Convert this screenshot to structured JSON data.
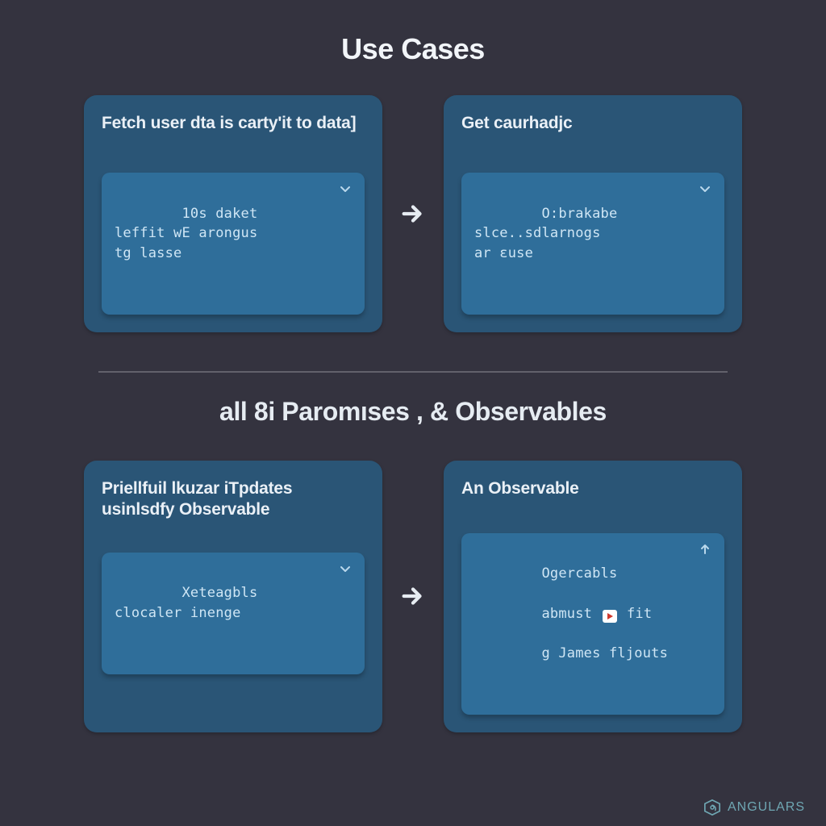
{
  "section1": {
    "title": "Use Cases",
    "cardA": {
      "title": "Fetch user dta is carty'it to data]",
      "code": "10s daket\nleffit wE arongus\ntg lasse",
      "ctrl": "chevron-down"
    },
    "cardB": {
      "title": "Get caurhadjc",
      "code": "O:brakabe\nslce..sdlarnogs\nar ɛuse",
      "ctrl": "chevron-down"
    }
  },
  "divider": true,
  "section2": {
    "title": "all 8i Paromıses , & Observables",
    "cardA": {
      "title": "Priellfuil lkuzar iTpdates usinlsdfy Observable",
      "code": "Xeteagbls\nclocaler inenge",
      "ctrl": "chevron-down"
    },
    "cardB": {
      "title": "An Observable",
      "code_line1": "Ogercabls",
      "code_line2_pre": "abmust ",
      "code_line2_post": " fit",
      "code_line3": "g James fljouts",
      "ctrl": "arrow-up"
    }
  },
  "footer": {
    "brand": "ANGULARS"
  }
}
